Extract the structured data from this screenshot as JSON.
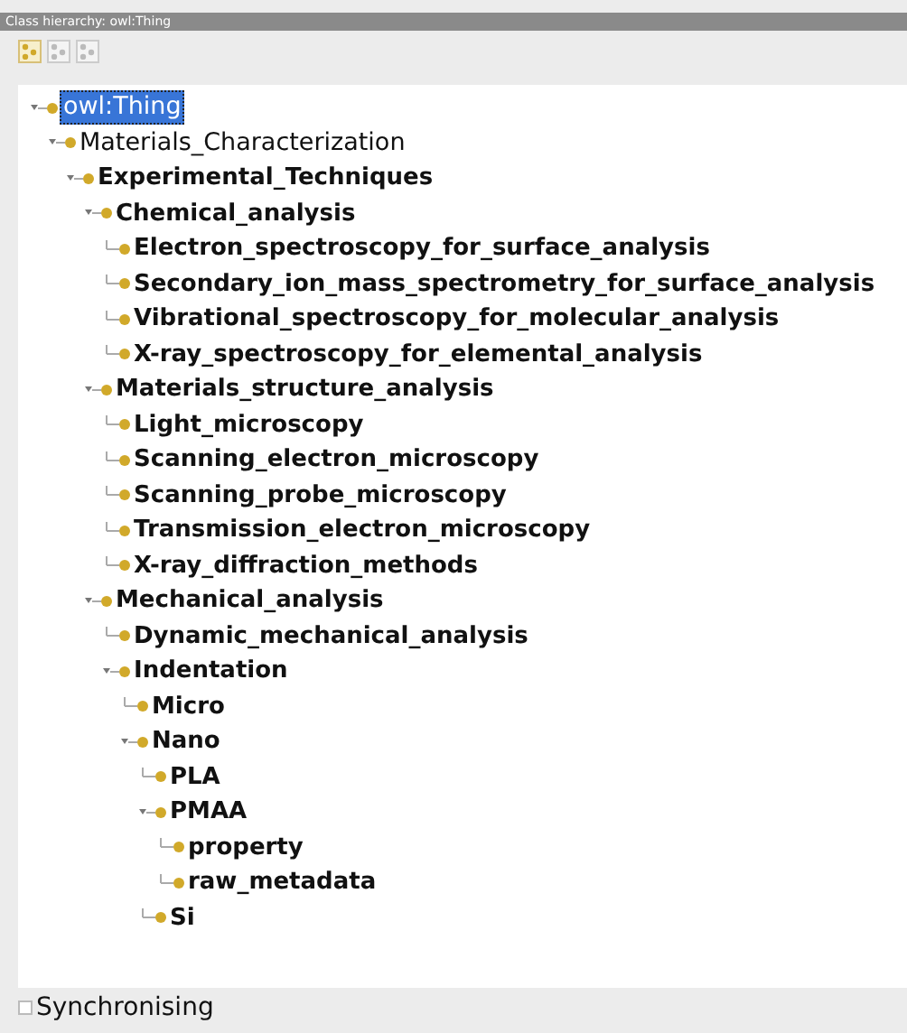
{
  "panel": {
    "title": "Class hierarchy: owl:Thing"
  },
  "toolbar": [
    {
      "disabled": false
    },
    {
      "disabled": true
    },
    {
      "disabled": true
    }
  ],
  "tree": [
    {
      "label": "owl:Thing",
      "bold": false,
      "selected": true,
      "children": [
        {
          "label": "Materials_Characterization",
          "bold": false,
          "selected": false,
          "children": [
            {
              "label": "Experimental_Techniques",
              "bold": true,
              "selected": false,
              "children": [
                {
                  "label": "Chemical_analysis",
                  "bold": true,
                  "selected": false,
                  "children": [
                    {
                      "label": "Electron_spectroscopy_for_surface_analysis",
                      "bold": true,
                      "selected": false
                    },
                    {
                      "label": "Secondary_ion_mass_spectrometry_for_surface_analysis",
                      "bold": true,
                      "selected": false
                    },
                    {
                      "label": "Vibrational_spectroscopy_for_molecular_analysis",
                      "bold": true,
                      "selected": false
                    },
                    {
                      "label": "X-ray_spectroscopy_for_elemental_analysis",
                      "bold": true,
                      "selected": false
                    }
                  ]
                },
                {
                  "label": "Materials_structure_analysis",
                  "bold": true,
                  "selected": false,
                  "children": [
                    {
                      "label": "Light_microscopy",
                      "bold": true,
                      "selected": false
                    },
                    {
                      "label": "Scanning_electron_microscopy",
                      "bold": true,
                      "selected": false
                    },
                    {
                      "label": "Scanning_probe_microscopy",
                      "bold": true,
                      "selected": false
                    },
                    {
                      "label": "Transmission_electron_microscopy",
                      "bold": true,
                      "selected": false
                    },
                    {
                      "label": "X-ray_diffraction_methods",
                      "bold": true,
                      "selected": false
                    }
                  ]
                },
                {
                  "label": "Mechanical_analysis",
                  "bold": true,
                  "selected": false,
                  "children": [
                    {
                      "label": "Dynamic_mechanical_analysis",
                      "bold": true,
                      "selected": false
                    },
                    {
                      "label": "Indentation",
                      "bold": true,
                      "selected": false,
                      "children": [
                        {
                          "label": "Micro",
                          "bold": true,
                          "selected": false
                        },
                        {
                          "label": "Nano",
                          "bold": true,
                          "selected": false,
                          "children": [
                            {
                              "label": "PLA",
                              "bold": true,
                              "selected": false
                            },
                            {
                              "label": "PMAA",
                              "bold": true,
                              "selected": false,
                              "children": [
                                {
                                  "label": "property",
                                  "bold": true,
                                  "selected": false
                                },
                                {
                                  "label": "raw_metadata",
                                  "bold": true,
                                  "selected": false
                                }
                              ]
                            },
                            {
                              "label": "Si",
                              "bold": true,
                              "selected": false
                            }
                          ]
                        }
                      ]
                    }
                  ]
                }
              ]
            }
          ]
        }
      ]
    }
  ],
  "status": {
    "label": "Synchronising",
    "checked": false
  }
}
